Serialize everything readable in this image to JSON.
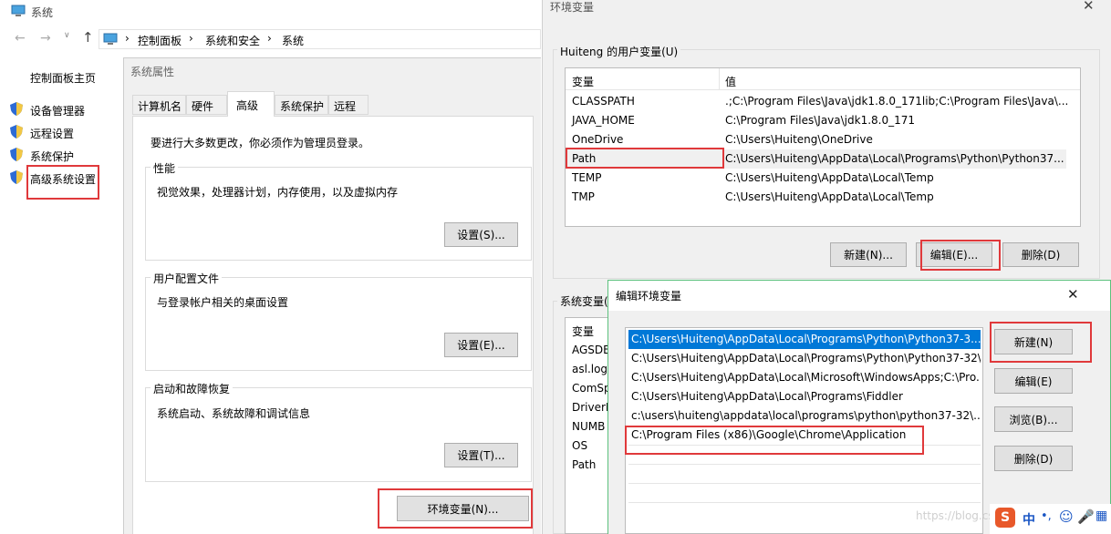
{
  "sys_window": {
    "title": "系统",
    "breadcrumb": [
      "控制面板",
      "系统和安全",
      "系统"
    ],
    "sidebar_home": "控制面板主页",
    "sidebar_items": [
      "设备管理器",
      "远程设置",
      "系统保护",
      "高级系统设置"
    ]
  },
  "sysprops": {
    "title": "系统属性",
    "tabs": [
      "计算机名",
      "硬件",
      "高级",
      "系统保护",
      "远程"
    ],
    "admin_note": "要进行大多数更改，你必须作为管理员登录。",
    "groups": [
      {
        "title": "性能",
        "desc": "视觉效果，处理器计划，内存使用，以及虚拟内存",
        "button": "设置(S)..."
      },
      {
        "title": "用户配置文件",
        "desc": "与登录帐户相关的桌面设置",
        "button": "设置(E)..."
      },
      {
        "title": "启动和故障恢复",
        "desc": "系统启动、系统故障和调试信息",
        "button": "设置(T)..."
      }
    ],
    "env_button": "环境变量(N)..."
  },
  "envvars": {
    "title": "环境变量",
    "user_group_title": "Huiteng 的用户变量(U)",
    "col_var": "变量",
    "col_val": "值",
    "user_vars": [
      {
        "name": "CLASSPATH",
        "value": ".;C:\\Program Files\\Java\\jdk1.8.0_171lib;C:\\Program Files\\Java\\..."
      },
      {
        "name": "JAVA_HOME",
        "value": "C:\\Program Files\\Java\\jdk1.8.0_171"
      },
      {
        "name": "OneDrive",
        "value": "C:\\Users\\Huiteng\\OneDrive"
      },
      {
        "name": "Path",
        "value": "C:\\Users\\Huiteng\\AppData\\Local\\Programs\\Python\\Python37..."
      },
      {
        "name": "TEMP",
        "value": "C:\\Users\\Huiteng\\AppData\\Local\\Temp"
      },
      {
        "name": "TMP",
        "value": "C:\\Users\\Huiteng\\AppData\\Local\\Temp"
      }
    ],
    "user_buttons": [
      "新建(N)...",
      "编辑(E)...",
      "删除(D)"
    ],
    "sys_group_title": "系统变量(",
    "sys_vars": [
      "AGSDE",
      "asl.log",
      "ComSp",
      "DriverD",
      "NUMB",
      "OS",
      "Path"
    ]
  },
  "editenv": {
    "title": "编辑环境变量",
    "entries": [
      "C:\\Users\\Huiteng\\AppData\\Local\\Programs\\Python\\Python37-3...",
      "C:\\Users\\Huiteng\\AppData\\Local\\Programs\\Python\\Python37-32\\",
      "C:\\Users\\Huiteng\\AppData\\Local\\Microsoft\\WindowsApps;C:\\Pro...",
      "C:\\Users\\Huiteng\\AppData\\Local\\Programs\\Fiddler",
      "c:\\users\\huiteng\\appdata\\local\\programs\\python\\python37-32\\...",
      "C:\\Program Files (x86)\\Google\\Chrome\\Application"
    ],
    "buttons": [
      "新建(N)",
      "编辑(E)",
      "浏览(B)...",
      "删除(D)"
    ]
  },
  "watermark": "https://blog.csdn",
  "tray_text": "中",
  "colors": {
    "highlight": "#e0393b",
    "selection": "#0078d7"
  }
}
